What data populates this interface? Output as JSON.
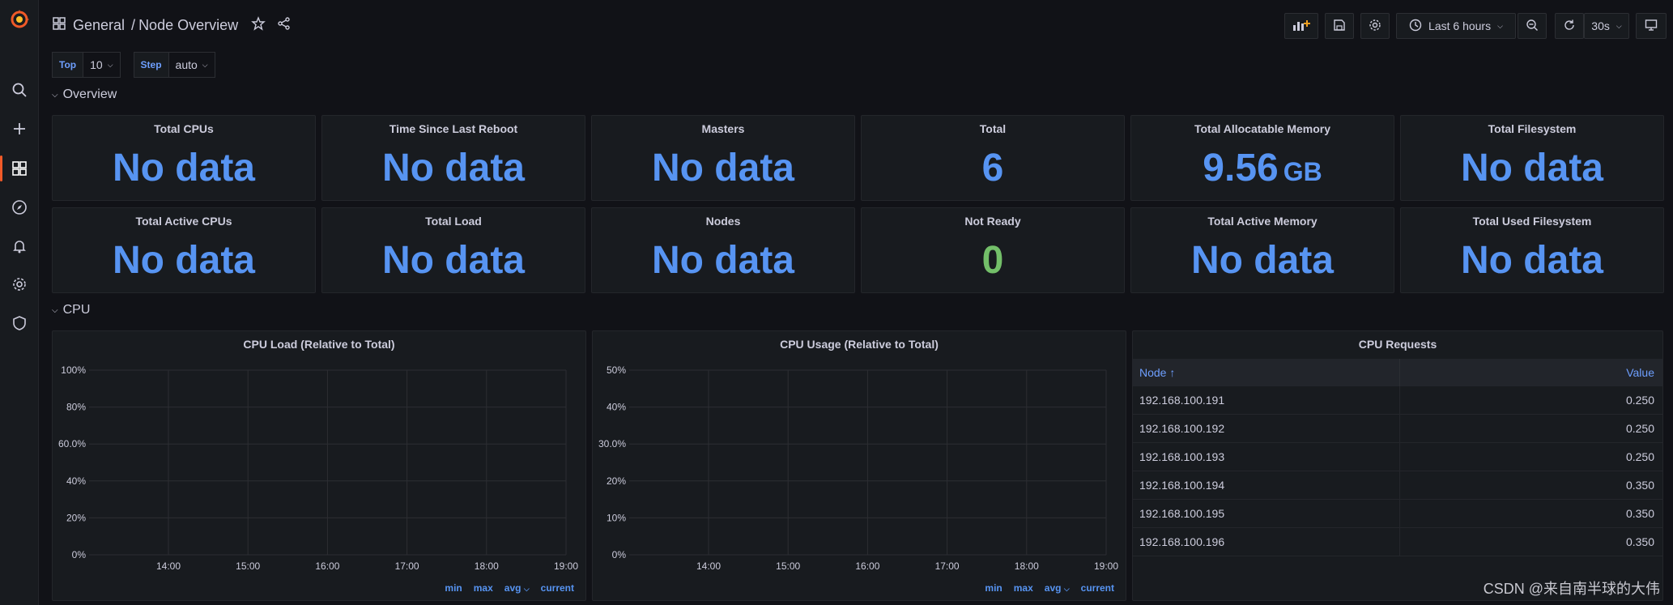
{
  "header": {
    "folder": "General",
    "separator": "/",
    "dashboard_title": "Node Overview",
    "time_range": "Last 6 hours",
    "refresh_interval": "30s"
  },
  "variables": [
    {
      "label": "Top",
      "value": "10"
    },
    {
      "label": "Step",
      "value": "auto"
    }
  ],
  "rows": {
    "overview": "Overview",
    "cpu": "CPU"
  },
  "stats": [
    {
      "title": "Total CPUs",
      "value": "No data",
      "unit": ""
    },
    {
      "title": "Time Since Last Reboot",
      "value": "No data",
      "unit": ""
    },
    {
      "title": "Masters",
      "value": "No data",
      "unit": ""
    },
    {
      "title": "Total",
      "value": "6",
      "unit": ""
    },
    {
      "title": "Total Allocatable Memory",
      "value": "9.56",
      "unit": "GB"
    },
    {
      "title": "Total Filesystem",
      "value": "No data",
      "unit": ""
    },
    {
      "title": "Total Active CPUs",
      "value": "No data",
      "unit": ""
    },
    {
      "title": "Total Load",
      "value": "No data",
      "unit": ""
    },
    {
      "title": "Nodes",
      "value": "No data",
      "unit": ""
    },
    {
      "title": "Not Ready",
      "value": "0",
      "unit": ""
    },
    {
      "title": "Total Active Memory",
      "value": "No data",
      "unit": ""
    },
    {
      "title": "Total Used Filesystem",
      "value": "No data",
      "unit": ""
    }
  ],
  "colors": {
    "stat_blue": "#5794f2",
    "stat_green": "#73bf69",
    "brand_orange": "#f05a28"
  },
  "chart_data": [
    {
      "type": "line",
      "title": "CPU Load (Relative to Total)",
      "x_ticks": [
        "14:00",
        "15:00",
        "16:00",
        "17:00",
        "18:00",
        "19:00"
      ],
      "y_ticks": [
        "0%",
        "20%",
        "40%",
        "60.0%",
        "80%",
        "100%"
      ],
      "ylim": [
        0,
        100
      ],
      "series": [],
      "legend_columns": [
        "min",
        "max",
        "avg",
        "current"
      ]
    },
    {
      "type": "line",
      "title": "CPU Usage (Relative to Total)",
      "x_ticks": [
        "14:00",
        "15:00",
        "16:00",
        "17:00",
        "18:00",
        "19:00"
      ],
      "y_ticks": [
        "0%",
        "10%",
        "20%",
        "30.0%",
        "40%",
        "50%"
      ],
      "ylim": [
        0,
        50
      ],
      "series": [],
      "legend_columns": [
        "min",
        "max",
        "avg",
        "current"
      ]
    }
  ],
  "cpu_requests": {
    "title": "CPU Requests",
    "col_node": "Node ↑",
    "col_value": "Value",
    "rows": [
      {
        "node": "192.168.100.191",
        "value": "0.250"
      },
      {
        "node": "192.168.100.192",
        "value": "0.250"
      },
      {
        "node": "192.168.100.193",
        "value": "0.250"
      },
      {
        "node": "192.168.100.194",
        "value": "0.350"
      },
      {
        "node": "192.168.100.195",
        "value": "0.350"
      },
      {
        "node": "192.168.100.196",
        "value": "0.350"
      }
    ]
  },
  "watermark": "CSDN @来自南半球的大伟"
}
